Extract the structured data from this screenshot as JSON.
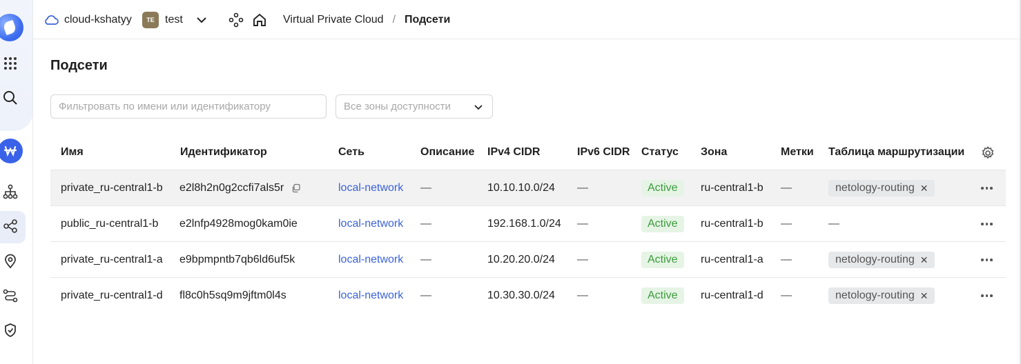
{
  "header": {
    "cloud_name": "cloud-kshatyy",
    "folder_badge": "TE",
    "folder_name": "test",
    "breadcrumb_service": "Virtual Private Cloud",
    "breadcrumb_separator": "/",
    "breadcrumb_current": "Подсети"
  },
  "page": {
    "title": "Подсети",
    "filter_placeholder": "Фильтровать по имени или идентификатору",
    "zone_select_value": "Все зоны доступности"
  },
  "table": {
    "columns": [
      "Имя",
      "Идентификатор",
      "Сеть",
      "Описание",
      "IPv4 CIDR",
      "IPv6 CIDR",
      "Статус",
      "Зона",
      "Метки",
      "Таблица маршрутизации"
    ],
    "rows": [
      {
        "name": "private_ru-central1-b",
        "id": "e2l8h2n0g2ccfi7als5r",
        "network": "local-network",
        "description": "—",
        "ipv4": "10.10.10.0/24",
        "ipv6": "—",
        "status": "Active",
        "zone": "ru-central1-b",
        "labels": "—",
        "route_table": "netology-routing"
      },
      {
        "name": "public_ru-central1-b",
        "id": "e2lnfp4928mog0kam0ie",
        "network": "local-network",
        "description": "—",
        "ipv4": "192.168.1.0/24",
        "ipv6": "—",
        "status": "Active",
        "zone": "ru-central1-b",
        "labels": "—",
        "route_table": "—"
      },
      {
        "name": "private_ru-central1-a",
        "id": "e9bpmpntb7qb6ld6uf5k",
        "network": "local-network",
        "description": "—",
        "ipv4": "10.20.20.0/24",
        "ipv6": "—",
        "status": "Active",
        "zone": "ru-central1-a",
        "labels": "—",
        "route_table": "netology-routing"
      },
      {
        "name": "private_ru-central1-d",
        "id": "fl8c0h5sq9m9jftm0l4s",
        "network": "local-network",
        "description": "—",
        "ipv4": "10.30.30.0/24",
        "ipv6": "—",
        "status": "Active",
        "zone": "ru-central1-d",
        "labels": "—",
        "route_table": "netology-routing"
      }
    ]
  },
  "colors": {
    "accent": "#3a62d8",
    "status_bg": "#e6f4e6",
    "status_text": "#3a9b3a",
    "folder_badge": "#8b7a57"
  },
  "icons": {
    "rail": [
      "logo-icon",
      "apps-grid-icon",
      "search-icon",
      "service-badge-icon",
      "network-icon",
      "subnets-icon",
      "location-pin-icon",
      "route-icon",
      "shield-icon"
    ],
    "header": [
      "cloud-icon",
      "chevron-down-icon",
      "structure-icon",
      "home-icon"
    ]
  }
}
